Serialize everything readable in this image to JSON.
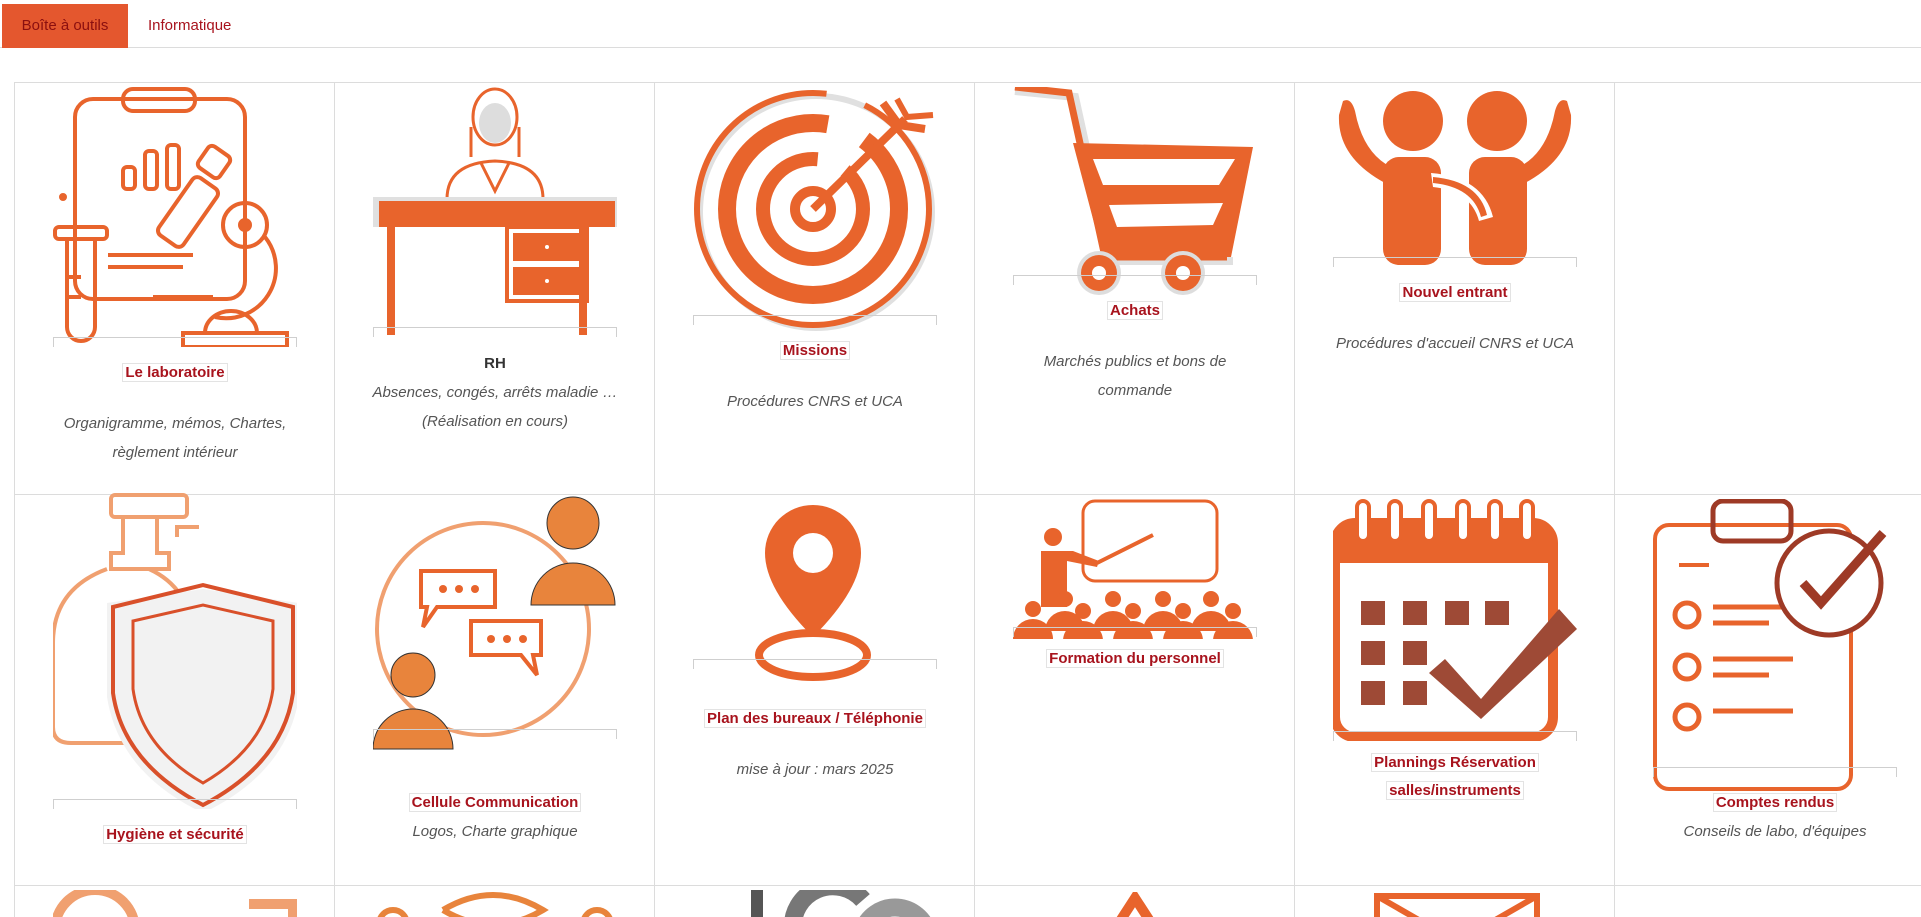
{
  "tabs": [
    {
      "label": "Boîte à outils"
    },
    {
      "label": "Informatique"
    }
  ],
  "colors": {
    "accent": "#e4572e",
    "orange": "#e8642c",
    "light_orange": "#f0a070",
    "dark_red": "#a8131d",
    "brown": "#9e4a36"
  },
  "tiles": [
    {
      "title": "Le laboratoire",
      "desc1": "Organigramme, mémos, Chartes,",
      "desc2": "règlement intérieur",
      "icon": "microscope-icon"
    },
    {
      "title": "RH",
      "desc1": "Absences, congés, arrêts maladie …",
      "desc2": "(Réalisation en cours)",
      "icon": "desk-person-icon"
    },
    {
      "title": "Missions",
      "desc1": "Procédures CNRS et UCA",
      "icon": "target-icon"
    },
    {
      "title": "Achats",
      "desc1": "Marchés publics et bons de",
      "desc2": "commande",
      "icon": "shopping-cart-icon"
    },
    {
      "title": "Nouvel entrant",
      "desc1": "Procédures d'accueil CNRS et UCA",
      "icon": "welcome-people-icon"
    },
    {
      "title": "Hygiène et sécurité",
      "icon": "shield-soap-icon"
    },
    {
      "title": "Cellule Communication",
      "desc1": "Logos, Charte graphique",
      "icon": "chat-people-icon"
    },
    {
      "title": "Plan des bureaux / Téléphonie",
      "desc1": "mise à jour : mars 2025",
      "icon": "map-pin-icon"
    },
    {
      "title": "Formation du personnel",
      "icon": "classroom-icon"
    },
    {
      "title": "Plannings Réservation",
      "title2": "salles/instruments",
      "icon": "calendar-check-icon"
    },
    {
      "title": "Comptes rendus",
      "desc1": "Conseils de labo, d'équipes",
      "icon": "clipboard-check-icon"
    }
  ]
}
